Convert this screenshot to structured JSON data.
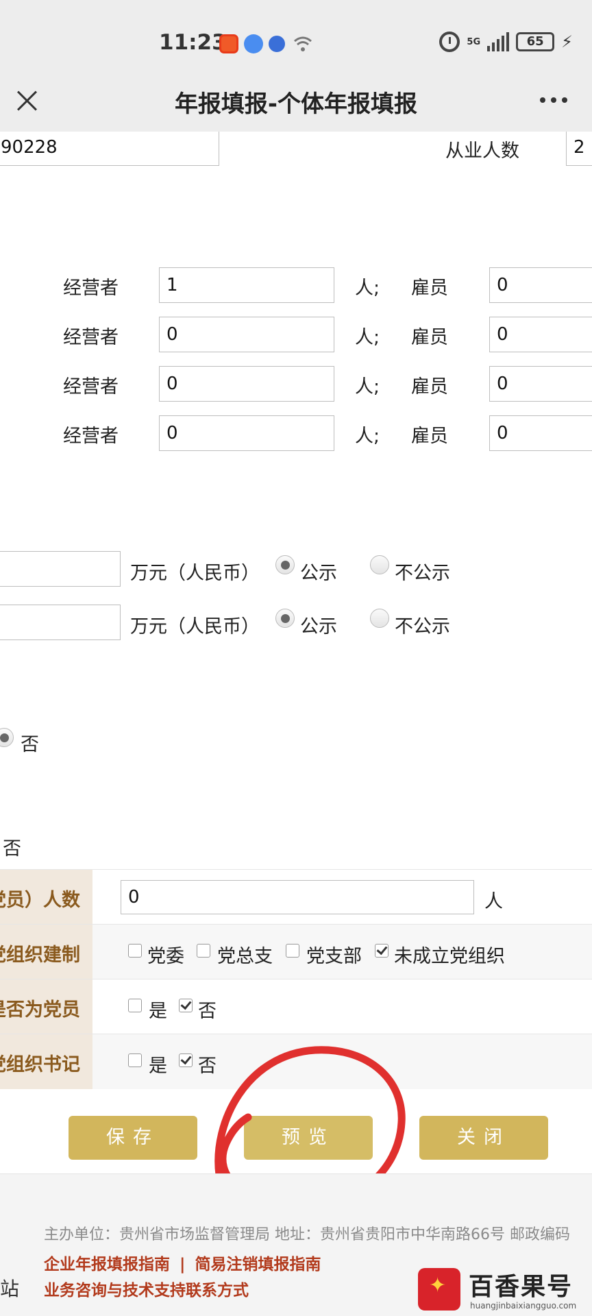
{
  "status_bar": {
    "time": "11:23",
    "network": "5G",
    "battery": "65",
    "icons": [
      "app-icon-orange",
      "music-icon",
      "baidu-paw-icon",
      "wifi-icon",
      "alarm-icon",
      "signal-icon",
      "battery-icon",
      "charging-icon"
    ]
  },
  "header": {
    "title": "年报填报-个体年报填报",
    "close_icon": "close-icon",
    "more_icon": "more-icon"
  },
  "top_row": {
    "partial_value": "90228",
    "employees_label": "从业人数",
    "employees_value": "2"
  },
  "staff_rows": [
    {
      "operator_label": "经营者",
      "operator_value": "1",
      "unit": "人;",
      "employee_label": "雇员",
      "employee_value": "0"
    },
    {
      "operator_label": "经营者",
      "operator_value": "0",
      "unit": "人;",
      "employee_label": "雇员",
      "employee_value": "0"
    },
    {
      "operator_label": "经营者",
      "operator_value": "0",
      "unit": "人;",
      "employee_label": "雇员",
      "employee_value": "0"
    },
    {
      "operator_label": "经营者",
      "operator_value": "0",
      "unit": "人;",
      "employee_label": "雇员",
      "employee_value": "0"
    }
  ],
  "money_rows": [
    {
      "value": "",
      "unit": "万元（人民币）",
      "public_label": "公示",
      "private_label": "不公示",
      "selected": "公示"
    },
    {
      "value": "",
      "unit": "万元（人民币）",
      "public_label": "公示",
      "private_label": "不公示",
      "selected": "公示"
    }
  ],
  "misc": {
    "no_radio_label": "否",
    "no_text": "否"
  },
  "party_table": {
    "rows": [
      {
        "header": "党员）人数",
        "input_value": "0",
        "unit": "人"
      },
      {
        "header": "党组织建制",
        "options": [
          {
            "label": "党委",
            "checked": false
          },
          {
            "label": "党总支",
            "checked": false
          },
          {
            "label": "党支部",
            "checked": false
          },
          {
            "label": "未成立党组织",
            "checked": true
          }
        ]
      },
      {
        "header": "是否为党员",
        "options": [
          {
            "label": "是",
            "checked": false
          },
          {
            "label": "否",
            "checked": true
          }
        ]
      },
      {
        "header": "党组织书记",
        "options": [
          {
            "label": "是",
            "checked": false
          },
          {
            "label": "否",
            "checked": true
          }
        ]
      }
    ]
  },
  "buttons": {
    "save": "保存",
    "preview": "预览",
    "close": "关闭",
    "button_color": "#d2b65c"
  },
  "footer": {
    "sponsor": "主办单位：贵州省市场监督管理局 地址：贵州省贵阳市中华南路66号 邮政编码",
    "guide_link_1": "企业年报填报指南",
    "separator": "|",
    "guide_link_2": "简易注销填报指南",
    "support_link": "业务咨询与技术支持联系方式",
    "edge_text": "站"
  },
  "watermark": {
    "name": "百香果号",
    "url": "huangjinbaixiangguo.com"
  },
  "colors": {
    "header_bg": "#ededed",
    "table_header_bg": "#f1e8dd",
    "table_header_text": "#8a5a1e",
    "link_red": "#b23a1c",
    "annotation_red": "#e0302e"
  }
}
